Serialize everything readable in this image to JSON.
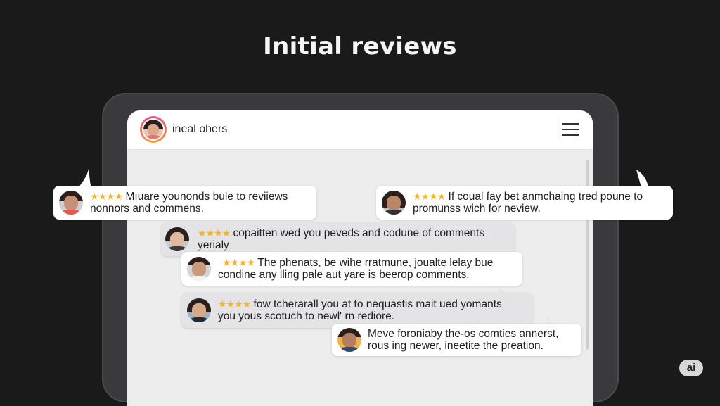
{
  "page": {
    "title": "Initial reviews"
  },
  "app": {
    "name": "ineal ohers"
  },
  "reviews": [
    {
      "stars": "★★★★",
      "line1": "Mıuare younonds bule to reviiews",
      "line2": "nonnors and commens."
    },
    {
      "stars": "★★★★",
      "line1": "If coual fay bet anmchaing tred poune to",
      "line2": "promunss wich for neview."
    },
    {
      "stars": "★★★★",
      "line1": "copaitten wed you peveds and codune of comments",
      "line2": "yerialy"
    },
    {
      "stars": "★★★★",
      "line1": "The phenats, be wihe rratmune, joualte lelay bue",
      "line2": "condine any lling pale aut yare is beerop comments."
    },
    {
      "stars": "★★★★",
      "line1": "fow tcherarall you at to nequastis mait ued yomants",
      "line2": "you yous scotuch to newl' rn rediore."
    },
    {
      "stars": "",
      "line1": "Meve foroniaby the-os comties annerst,",
      "line2": "rous ing newer, ineetite the preation."
    }
  ],
  "badge": {
    "label": "ai"
  },
  "colors": {
    "background": "#1a1a1b",
    "star": "#f2b52f",
    "card": "#ffffff"
  }
}
